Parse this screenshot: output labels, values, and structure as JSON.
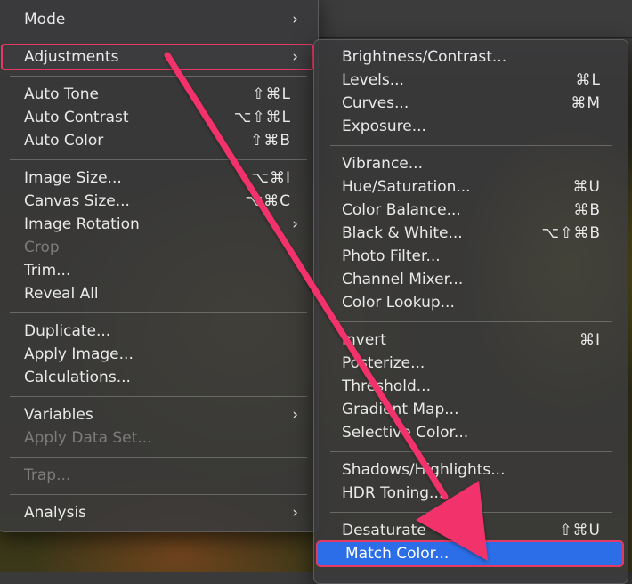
{
  "main_menu": {
    "mode": {
      "label": "Mode",
      "chevron": "›"
    },
    "adjustments": {
      "label": "Adjustments",
      "chevron": "›"
    },
    "auto_tone": {
      "label": "Auto Tone",
      "shortcut": "⇧⌘L"
    },
    "auto_contrast": {
      "label": "Auto Contrast",
      "shortcut": "⌥⇧⌘L"
    },
    "auto_color": {
      "label": "Auto Color",
      "shortcut": "⇧⌘B"
    },
    "image_size": {
      "label": "Image Size...",
      "shortcut": "⌥⌘I"
    },
    "canvas_size": {
      "label": "Canvas Size...",
      "shortcut": "⌥⌘C"
    },
    "image_rotation": {
      "label": "Image Rotation",
      "chevron": "›"
    },
    "crop": {
      "label": "Crop"
    },
    "trim": {
      "label": "Trim..."
    },
    "reveal_all": {
      "label": "Reveal All"
    },
    "duplicate": {
      "label": "Duplicate..."
    },
    "apply_image": {
      "label": "Apply Image..."
    },
    "calculations": {
      "label": "Calculations..."
    },
    "variables": {
      "label": "Variables",
      "chevron": "›"
    },
    "apply_data_set": {
      "label": "Apply Data Set..."
    },
    "trap": {
      "label": "Trap..."
    },
    "analysis": {
      "label": "Analysis",
      "chevron": "›"
    }
  },
  "sub_menu": {
    "brightness_contrast": {
      "label": "Brightness/Contrast..."
    },
    "levels": {
      "label": "Levels...",
      "shortcut": "⌘L"
    },
    "curves": {
      "label": "Curves...",
      "shortcut": "⌘M"
    },
    "exposure": {
      "label": "Exposure..."
    },
    "vibrance": {
      "label": "Vibrance..."
    },
    "hue_saturation": {
      "label": "Hue/Saturation...",
      "shortcut": "⌘U"
    },
    "color_balance": {
      "label": "Color Balance...",
      "shortcut": "⌘B"
    },
    "black_white": {
      "label": "Black & White...",
      "shortcut": "⌥⇧⌘B"
    },
    "photo_filter": {
      "label": "Photo Filter..."
    },
    "channel_mixer": {
      "label": "Channel Mixer..."
    },
    "color_lookup": {
      "label": "Color Lookup..."
    },
    "invert": {
      "label": "Invert",
      "shortcut": "⌘I"
    },
    "posterize": {
      "label": "Posterize..."
    },
    "threshold": {
      "label": "Threshold..."
    },
    "gradient_map": {
      "label": "Gradient Map..."
    },
    "selective_color": {
      "label": "Selective Color..."
    },
    "shadows_highlights": {
      "label": "Shadows/Highlights..."
    },
    "hdr_toning": {
      "label": "HDR Toning..."
    },
    "desaturate": {
      "label": "Desaturate",
      "shortcut": "⇧⌘U"
    },
    "match_color": {
      "label": "Match Color..."
    }
  },
  "colors": {
    "highlight": "#2c6ee8",
    "annotation": "#e23a63"
  }
}
